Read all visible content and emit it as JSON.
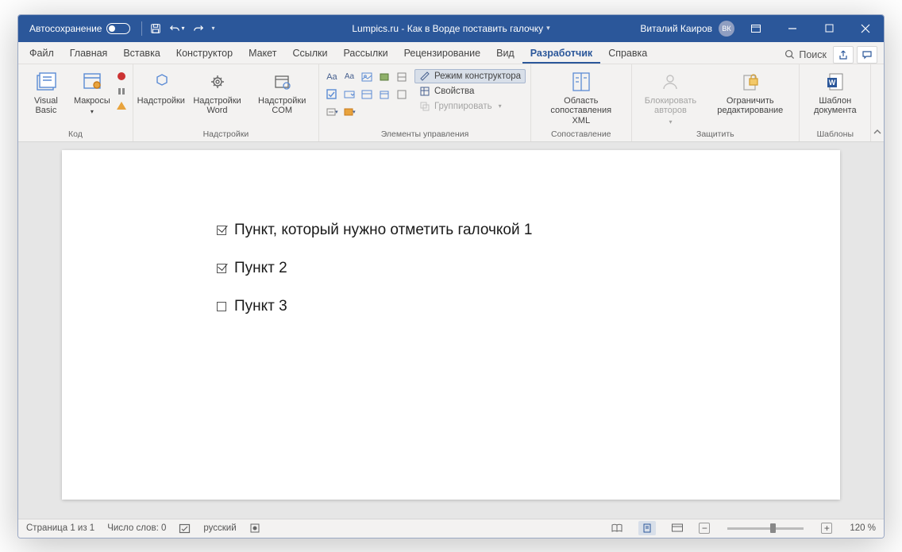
{
  "titlebar": {
    "autosave": "Автосохранение",
    "doctitle": "Lumpics.ru - Как в Ворде поставить галочку",
    "username": "Виталий Каиров",
    "avatar": "ВК"
  },
  "tabs": [
    "Файл",
    "Главная",
    "Вставка",
    "Конструктор",
    "Макет",
    "Ссылки",
    "Рассылки",
    "Рецензирование",
    "Вид",
    "Разработчик",
    "Справка"
  ],
  "active_tab": 9,
  "search": "Поиск",
  "ribbon": {
    "groups": [
      {
        "label": "Код",
        "items": [
          "Visual Basic",
          "Макросы"
        ]
      },
      {
        "label": "Надстройки",
        "items": [
          "Надстройки",
          "Надстройки Word",
          "Надстройки COM"
        ]
      },
      {
        "label": "Элементы управления",
        "design": "Режим конструктора",
        "props": "Свойства",
        "group": "Группировать"
      },
      {
        "label": "Сопоставление",
        "items": [
          "Область сопоставления XML"
        ]
      },
      {
        "label": "Защитить",
        "items": [
          "Блокировать авторов",
          "Ограничить редактирование"
        ]
      },
      {
        "label": "Шаблоны",
        "items": [
          "Шаблон документа"
        ]
      }
    ]
  },
  "document": {
    "lines": [
      {
        "checked": true,
        "text": "Пункт, который нужно отметить галочкой 1"
      },
      {
        "checked": true,
        "text": "Пункт 2"
      },
      {
        "checked": false,
        "text": "Пункт 3"
      }
    ]
  },
  "status": {
    "page": "Страница 1 из 1",
    "words": "Число слов: 0",
    "lang": "русский",
    "zoom": "120 %"
  }
}
